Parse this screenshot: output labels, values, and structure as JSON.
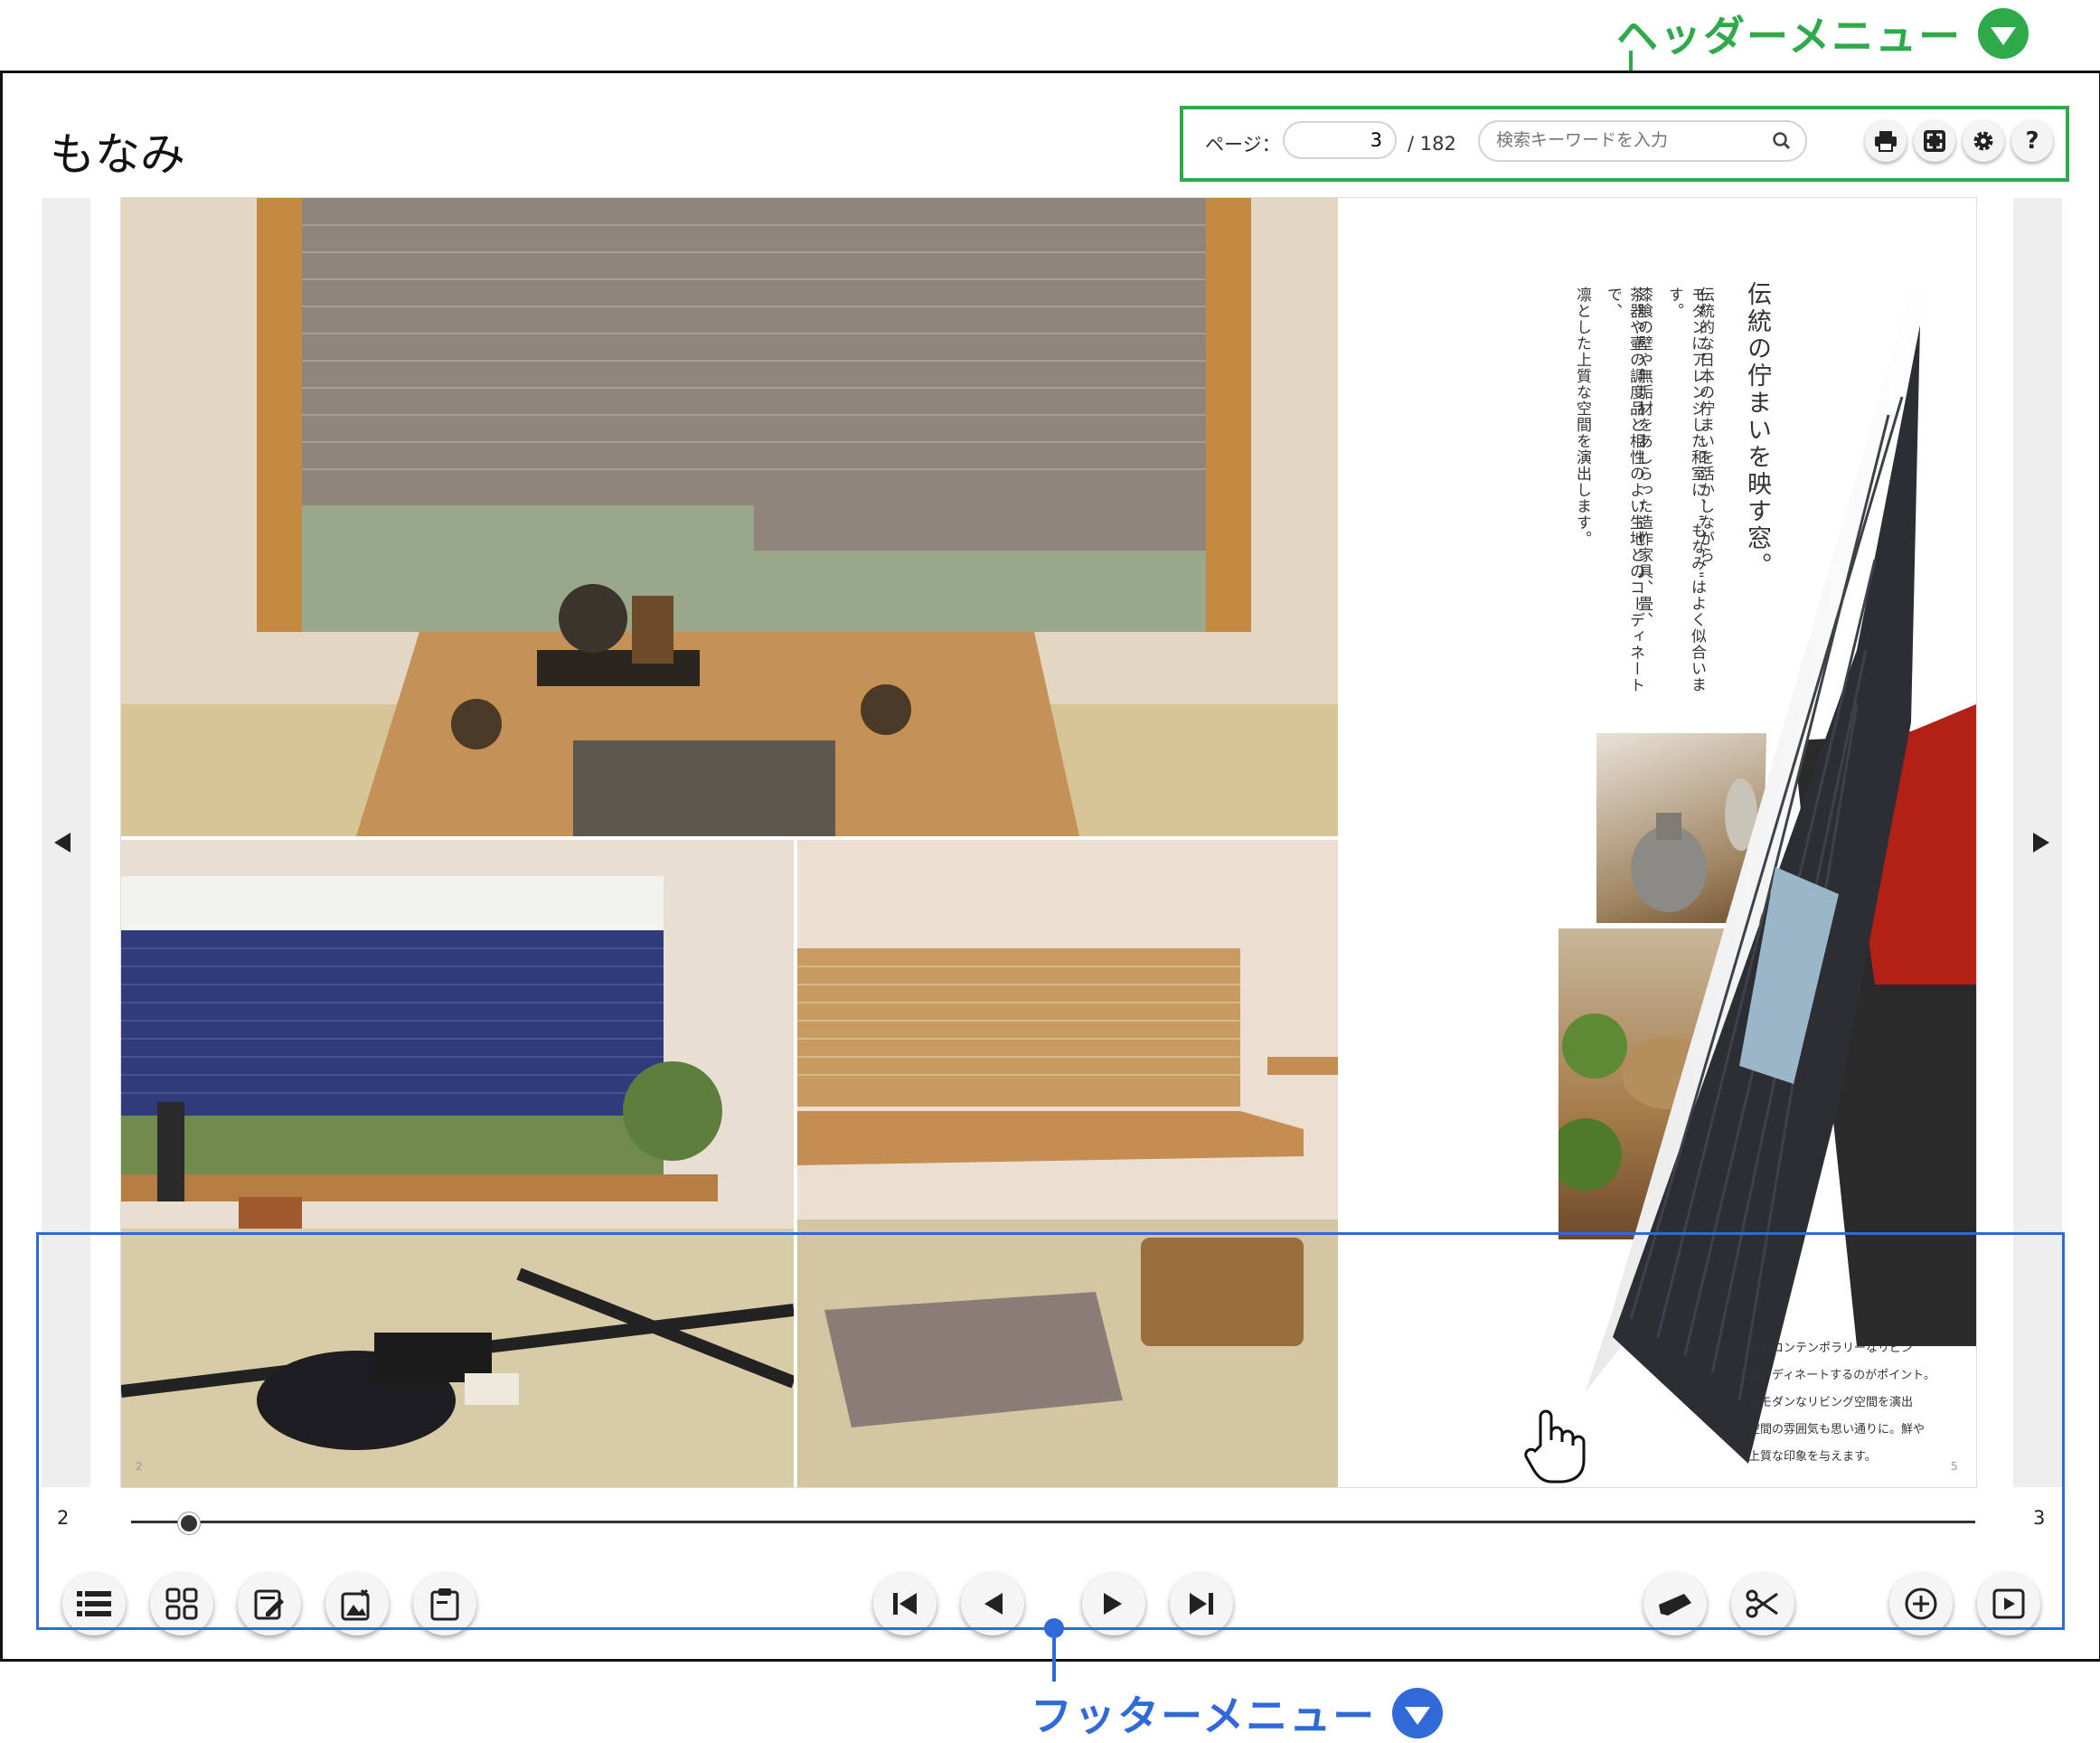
{
  "annotations": {
    "header_label": "ヘッダーメニュー",
    "footer_label": "フッターメニュー",
    "header_color": "#2eaa4a",
    "footer_color": "#2f6ad8"
  },
  "viewer": {
    "logo": "もなみ"
  },
  "header": {
    "page_label": "ページ：",
    "page_value": "3",
    "page_total": "/ 182",
    "search_placeholder": "検索キーワードを入力",
    "icons": [
      "print-icon",
      "fullscreen-icon",
      "gear-icon",
      "help-icon"
    ],
    "help_glyph": "?"
  },
  "book": {
    "left_page_number": "2",
    "right_page_number": "5",
    "headline": "伝統の佇まいを映す窓。",
    "body_lines": [
      "伝統的な日本の佇まいを活かしながら",
      "モダンにアレンジした和室に、\"もなみ\"はよく似合います。",
      "漆喰の壁や無垢材をあしらった造作家具、畳、",
      "茶器や壷の調度品と相性のよい生地とのコーディネートで、",
      "凛とした上質な空間を演出します。"
    ],
    "next_page_fragment": [
      "れたコンテンポラリーなリビン",
      "コーディネートするのがポイント。",
      "にモダンなリビング空間を演出",
      "空間の雰囲気も思い通りに。鮮や",
      "上質な印象を与えます。"
    ]
  },
  "footer": {
    "slider_left": "2",
    "slider_right": "3",
    "slider_position": 0.03,
    "left_buttons": [
      "list-icon",
      "thumbnails-icon",
      "memo-icon",
      "image-edit-icon",
      "clipboard-icon"
    ],
    "nav_buttons": [
      "first-page-icon",
      "prev-page-icon",
      "next-page-icon",
      "last-page-icon"
    ],
    "right_buttons": [
      "highlighter-icon",
      "scissors-icon",
      "zoom-in-icon",
      "slideshow-icon"
    ]
  }
}
